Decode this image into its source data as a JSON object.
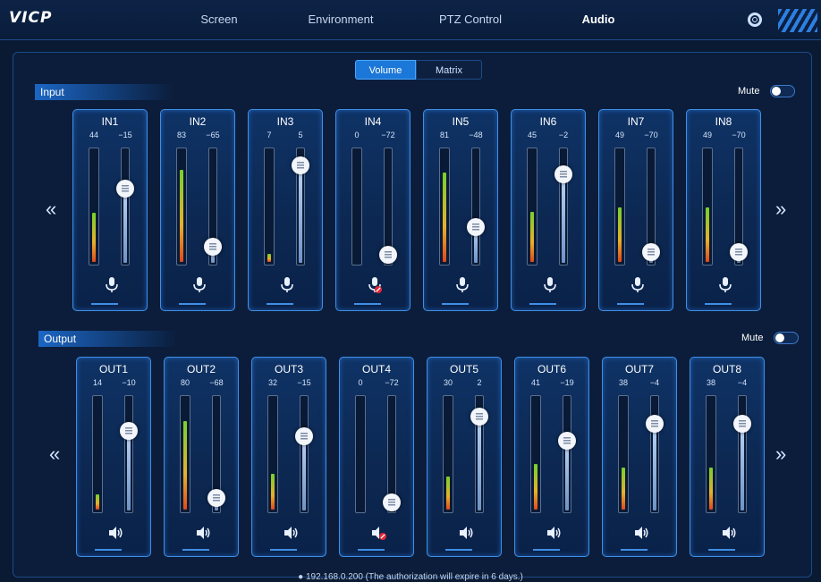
{
  "app": {
    "logo": "VICP"
  },
  "nav": {
    "tabs": [
      {
        "label": "Screen",
        "active": false
      },
      {
        "label": "Environment",
        "active": false
      },
      {
        "label": "PTZ Control",
        "active": false
      },
      {
        "label": "Audio",
        "active": true
      }
    ],
    "settings_icon": "gear-icon"
  },
  "view_switch": {
    "volume_label": "Volume",
    "matrix_label": "Matrix",
    "selected": "Volume"
  },
  "input": {
    "title": "Input",
    "mute_label": "Mute",
    "mute_on": false,
    "channels": [
      {
        "name": "IN1",
        "level": 44,
        "gain": -15,
        "muted": false
      },
      {
        "name": "IN2",
        "level": 83,
        "gain": -65,
        "muted": false
      },
      {
        "name": "IN3",
        "level": 7,
        "gain": 5,
        "muted": false
      },
      {
        "name": "IN4",
        "level": 0,
        "gain": -72,
        "muted": true
      },
      {
        "name": "IN5",
        "level": 81,
        "gain": -48,
        "muted": false
      },
      {
        "name": "IN6",
        "level": 45,
        "gain": -2,
        "muted": false
      },
      {
        "name": "IN7",
        "level": 49,
        "gain": -70,
        "muted": false
      },
      {
        "name": "IN8",
        "level": 49,
        "gain": -70,
        "muted": false
      }
    ],
    "icon": "microphone-icon"
  },
  "output": {
    "title": "Output",
    "mute_label": "Mute",
    "mute_on": false,
    "channels": [
      {
        "name": "OUT1",
        "level": 14,
        "gain": -10,
        "muted": false
      },
      {
        "name": "OUT2",
        "level": 80,
        "gain": -68,
        "muted": false
      },
      {
        "name": "OUT3",
        "level": 32,
        "gain": -15,
        "muted": false
      },
      {
        "name": "OUT4",
        "level": 0,
        "gain": -72,
        "muted": true
      },
      {
        "name": "OUT5",
        "level": 30,
        "gain": 2,
        "muted": false
      },
      {
        "name": "OUT6",
        "level": 41,
        "gain": -19,
        "muted": false
      },
      {
        "name": "OUT7",
        "level": 38,
        "gain": -4,
        "muted": false
      },
      {
        "name": "OUT8",
        "level": 38,
        "gain": -4,
        "muted": false
      }
    ],
    "icon": "speaker-icon"
  },
  "pager": {
    "prev": "«",
    "next": "»"
  },
  "status": {
    "text": "● 192.168.0.200   (The authorization will expire in 6 days.)"
  },
  "colors": {
    "accent": "#1c78d8",
    "background": "#0a1a33",
    "card_border": "#3f8fe6",
    "mute_badge": "#e0283a"
  }
}
